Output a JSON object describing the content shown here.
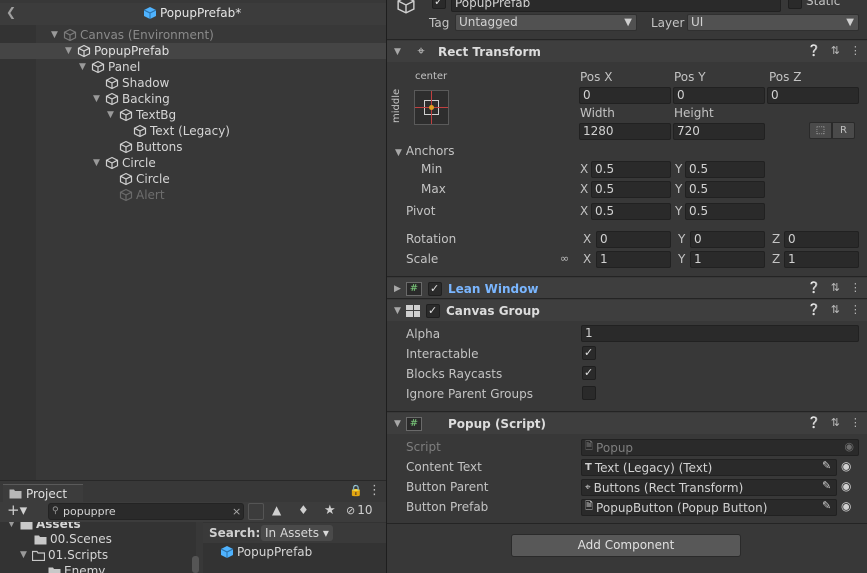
{
  "hierarchy": {
    "title": "PopupPrefab*",
    "items": [
      {
        "label": "Canvas (Environment)"
      },
      {
        "label": "PopupPrefab"
      },
      {
        "label": "Panel"
      },
      {
        "label": "Shadow"
      },
      {
        "label": "Backing"
      },
      {
        "label": "TextBg"
      },
      {
        "label": "Text (Legacy)"
      },
      {
        "label": "Buttons"
      },
      {
        "label": "Circle"
      },
      {
        "label": "Circle"
      },
      {
        "label": "Alert"
      }
    ]
  },
  "project": {
    "tab_label": "Project",
    "search_value": "popuppre",
    "hidden_count": "10",
    "tree": [
      {
        "label": "Assets"
      },
      {
        "label": "00.Scenes"
      },
      {
        "label": "01.Scripts"
      },
      {
        "label": "Enemy"
      }
    ],
    "search_label": "Search:",
    "search_scope": "In Assets",
    "results": [
      {
        "label": "PopupPrefab"
      }
    ]
  },
  "inspector": {
    "object_name": "PopupPrefab",
    "static_label": "Static",
    "tag_label": "Tag",
    "tag_value": "Untagged",
    "layer_label": "Layer",
    "layer_value": "UI",
    "rect_transform": {
      "title": "Rect Transform",
      "anchor_preset_h": "center",
      "anchor_preset_v": "middle",
      "pos_x_label": "Pos X",
      "pos_x": "0",
      "pos_y_label": "Pos Y",
      "pos_y": "0",
      "pos_z_label": "Pos Z",
      "pos_z": "0",
      "width_label": "Width",
      "width": "1280",
      "height_label": "Height",
      "height": "720",
      "raw_button": "R",
      "anchors_label": "Anchors",
      "min_label": "Min",
      "min_x": "0.5",
      "min_y": "0.5",
      "max_label": "Max",
      "max_x": "0.5",
      "max_y": "0.5",
      "pivot_label": "Pivot",
      "pivot_x": "0.5",
      "pivot_y": "0.5",
      "rotation_label": "Rotation",
      "rot_x": "0",
      "rot_y": "0",
      "rot_z": "0",
      "scale_label": "Scale",
      "scale_x": "1",
      "scale_y": "1",
      "scale_z": "1",
      "x": "X",
      "y": "Y",
      "z": "Z"
    },
    "lean_window": {
      "title": "Lean Window"
    },
    "canvas_group": {
      "title": "Canvas Group",
      "alpha_label": "Alpha",
      "alpha": "1",
      "interactable_label": "Interactable",
      "blocks_raycasts_label": "Blocks Raycasts",
      "ignore_parent_label": "Ignore Parent Groups"
    },
    "popup_script": {
      "title": "Popup (Script)",
      "script_label": "Script",
      "script_value": "Popup",
      "content_text_label": "Content Text",
      "content_text_value": "Text (Legacy) (Text)",
      "button_parent_label": "Button Parent",
      "button_parent_value": "Buttons (Rect Transform)",
      "button_prefab_label": "Button Prefab",
      "button_prefab_value": "PopupButton (Popup Button)"
    },
    "add_component": "Add Component"
  },
  "colors": {
    "accent_blue": "#4fb3ff",
    "link_blue": "#7ab6ff",
    "panel_bg": "#383838"
  }
}
